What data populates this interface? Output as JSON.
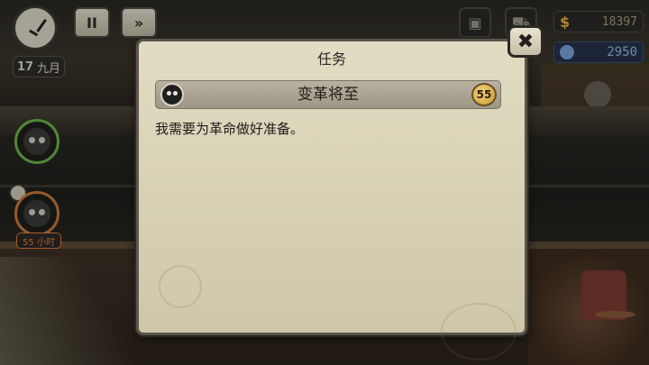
{
  "hud": {
    "pause_label": "II",
    "fast_forward_label": "»",
    "date": {
      "day": "17",
      "month": "九月"
    },
    "timer": "55 小时",
    "money": {
      "symbol": "$",
      "value": "18397"
    },
    "gems": {
      "value": "2950"
    }
  },
  "dialog": {
    "title": "任务",
    "close_label": "✖",
    "mission": {
      "name": "变革将至",
      "reward": "55",
      "description": "我需要为革命做好准备。"
    }
  },
  "icons": [
    "clock-icon",
    "pause-icon",
    "fast-forward-icon",
    "bag-icon",
    "cart-icon",
    "dollar-icon",
    "gem-icon",
    "close-icon",
    "resistance-icon",
    "character-portrait",
    "reward-coin"
  ]
}
